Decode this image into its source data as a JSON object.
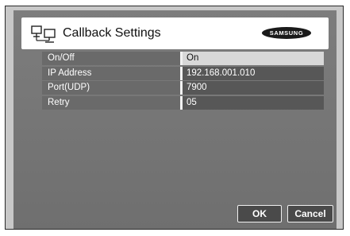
{
  "dialog": {
    "title": "Callback Settings",
    "title_icon": "network-computers-icon",
    "brand": "SAMSUNG"
  },
  "settings": [
    {
      "label": "On/Off",
      "value": "On"
    },
    {
      "label": "IP Address",
      "value": "192.168.001.010"
    },
    {
      "label": "Port(UDP)",
      "value": "7900"
    },
    {
      "label": "Retry",
      "value": "05"
    }
  ],
  "buttons": {
    "ok_label": "OK",
    "cancel_label": "Cancel"
  },
  "colors": {
    "panel": "#767676",
    "selected_value_bg": "#d8d8d8",
    "frame": "#c8c8c8"
  }
}
